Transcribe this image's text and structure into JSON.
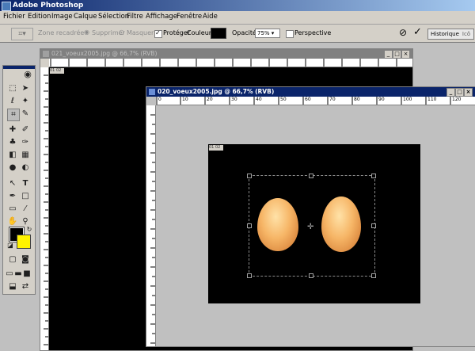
{
  "app": {
    "title": "Adobe Photoshop"
  },
  "menu": [
    "Fichier",
    "Edition",
    "Image",
    "Calque",
    "Sélection",
    "Filtre",
    "Affichage",
    "Fenêtre",
    "Aide"
  ],
  "options": {
    "mode_label": "Zone recadrée",
    "supprimer": "Supprimer",
    "masquer": "Masquer",
    "proteger": "Protéger",
    "couleur": "Couleur :",
    "opacite_label": "Opacité :",
    "opacite_value": "75%",
    "perspective": "Perspective",
    "historique": "Historique",
    "historique_icon": "Icô"
  },
  "doc1": {
    "title": "021_voeux2005.jpg @ 66,7% (RVB)",
    "layer_tag": "01 02"
  },
  "doc2": {
    "title": "020_voeux2005.jpg @ 66,7% (RVB)",
    "layer_tag": "01 02",
    "ruler_labels": [
      "0",
      "10",
      "20",
      "30",
      "40",
      "50",
      "60",
      "70",
      "80",
      "90",
      "100",
      "110",
      "120"
    ]
  },
  "colors": {
    "title_active": "#0a246a",
    "background_swatch": "#fff200",
    "foreground_swatch": "#000000"
  }
}
